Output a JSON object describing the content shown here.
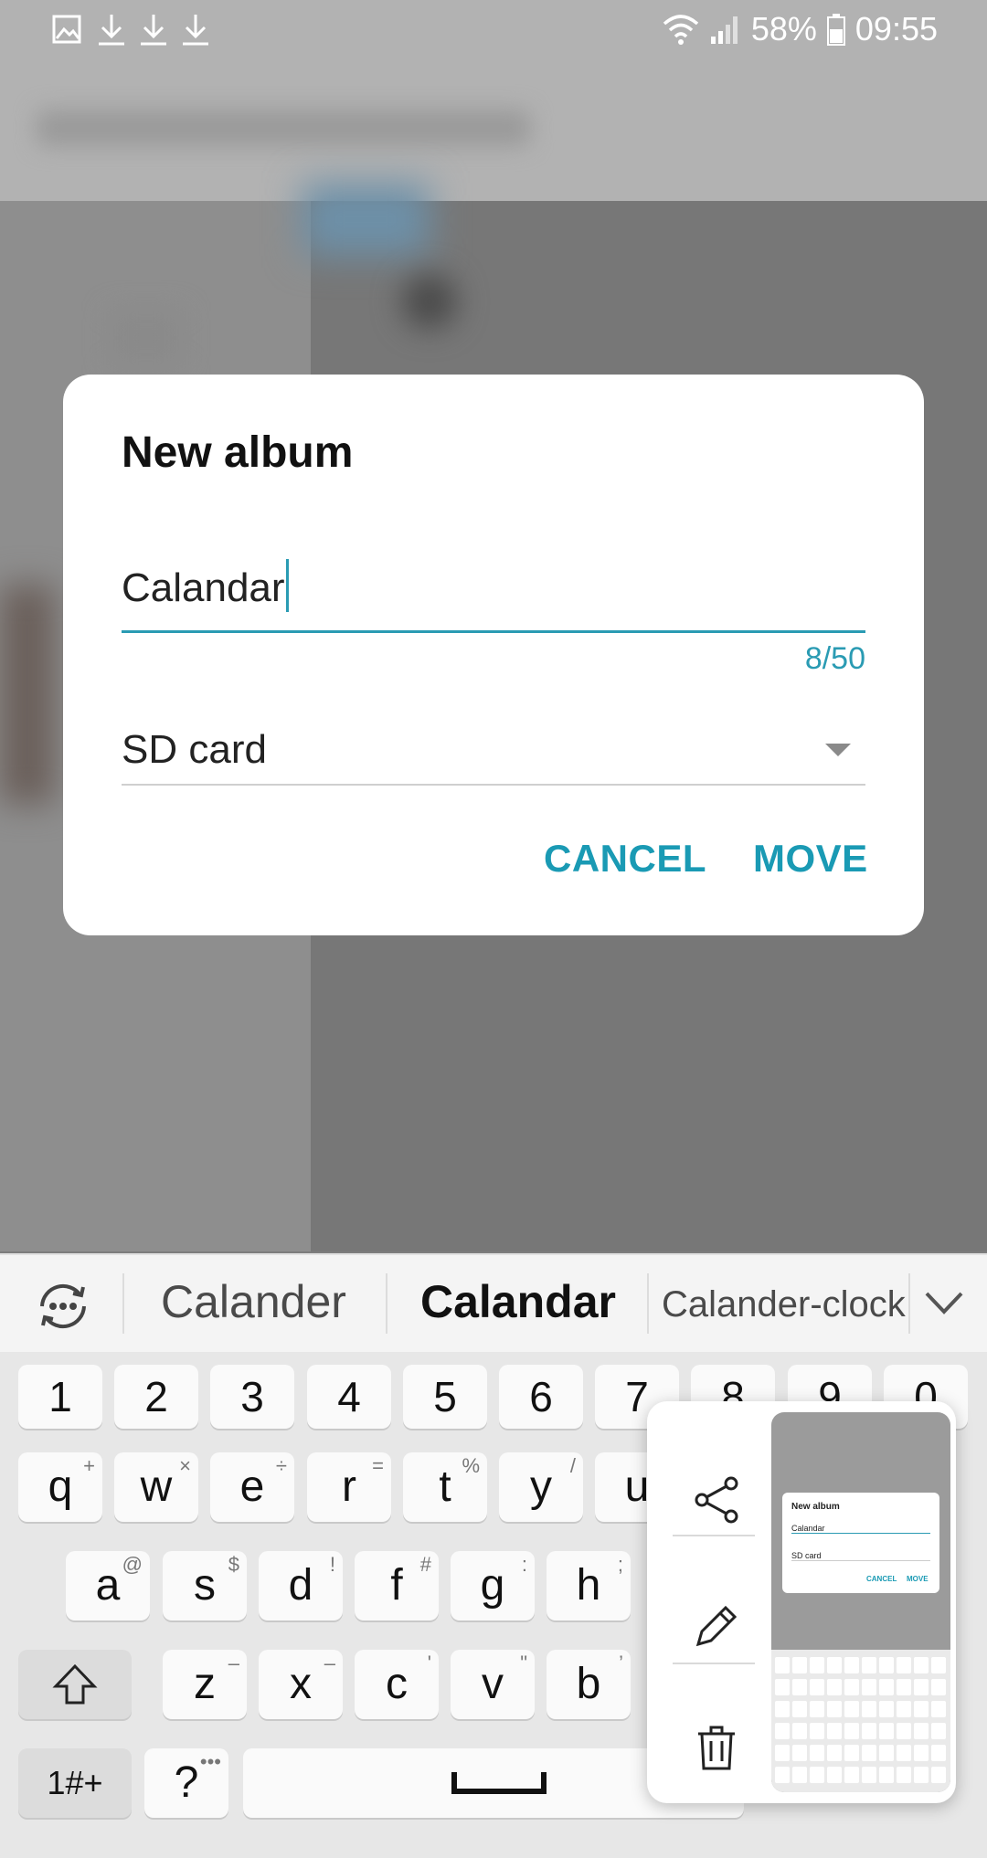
{
  "status_bar": {
    "notification_icons": [
      "gallery-icon",
      "download-icon",
      "download-icon",
      "download-icon"
    ],
    "battery": "58%",
    "time": "09:55"
  },
  "dialog": {
    "title": "New album",
    "name_value": "Calandar",
    "counter": "8/50",
    "storage_value": "SD card",
    "cancel_label": "CANCEL",
    "move_label": "MOVE"
  },
  "keyboard": {
    "suggestions": [
      "Calander",
      "Calandar",
      "Calander-clock"
    ],
    "number_row": [
      "1",
      "2",
      "3",
      "4",
      "5",
      "6",
      "7",
      "8",
      "9",
      "0"
    ],
    "row1": [
      {
        "k": "q",
        "s": "+"
      },
      {
        "k": "w",
        "s": "×"
      },
      {
        "k": "e",
        "s": "÷"
      },
      {
        "k": "r",
        "s": "="
      },
      {
        "k": "t",
        "s": "%"
      },
      {
        "k": "y",
        "s": "/"
      },
      {
        "k": "u",
        "s": ""
      }
    ],
    "row2": [
      {
        "k": "a",
        "s": "@"
      },
      {
        "k": "s",
        "s": "$"
      },
      {
        "k": "d",
        "s": "!"
      },
      {
        "k": "f",
        "s": "#"
      },
      {
        "k": "g",
        "s": ":"
      },
      {
        "k": "h",
        "s": ";"
      }
    ],
    "row3": [
      {
        "k": "z",
        "s": "–"
      },
      {
        "k": "x",
        "s": "–"
      },
      {
        "k": "c",
        "s": "'"
      },
      {
        "k": "v",
        "s": "\""
      },
      {
        "k": "b",
        "s": "’"
      }
    ],
    "symbols_label": "1#+",
    "question_label": "?",
    "question_sup": "•••"
  },
  "screenshot_overlay": {
    "thumb_title": "New album",
    "thumb_value": "Calandar",
    "thumb_storage": "SD card",
    "thumb_cancel": "CANCEL",
    "thumb_move": "MOVE"
  },
  "colors": {
    "accent": "#1a9ab4",
    "dialog_bg": "#ffffff",
    "keyboard_bg": "#e7e7e7"
  }
}
